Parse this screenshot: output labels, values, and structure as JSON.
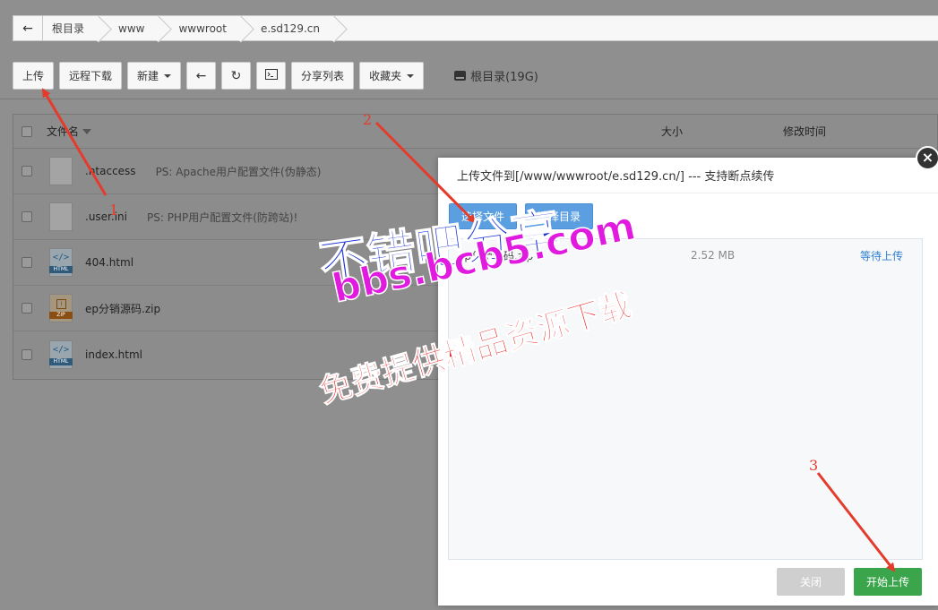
{
  "breadcrumb": {
    "items": [
      "根目录",
      "www",
      "wwwroot",
      "e.sd129.cn"
    ]
  },
  "toolbar": {
    "upload": "上传",
    "remote_download": "远程下载",
    "new": "新建",
    "share_list": "分享列表",
    "favorites": "收藏夹",
    "disk": "根目录(19G)"
  },
  "file_table": {
    "col_name": "文件名",
    "col_size": "大小",
    "col_time": "修改时间",
    "rows": [
      {
        "name": ".htaccess",
        "note": "PS: Apache用户配置文件(伪静态)",
        "icon": "file-icon"
      },
      {
        "name": ".user.ini",
        "note": "PS: PHP用户配置文件(防跨站)!",
        "icon": "file-icon"
      },
      {
        "name": "404.html",
        "note": "",
        "icon": "html-file-icon"
      },
      {
        "name": "ep分销源码.zip",
        "note": "",
        "icon": "zip-file-icon"
      },
      {
        "name": "index.html",
        "note": "",
        "icon": "html-file-icon"
      }
    ]
  },
  "dialog": {
    "title": "上传文件到[/www/wwwroot/e.sd129.cn/] --- 支持断点续传",
    "select_file": "选择文件",
    "select_dir": "选择目录",
    "queue": [
      {
        "name": "ep分销源码.zip",
        "size": "2.52 MB",
        "status": "等待上传"
      }
    ],
    "close": "关闭",
    "start_upload": "开始上传"
  },
  "annotations": {
    "step1": "1",
    "step2": "2",
    "step3": "3",
    "arrow_color": "#e53b2c",
    "watermark_line1": "不错吧分享",
    "watermark_line2": "bbs.bcb5.com",
    "watermark_line3": "免费提供精品资源下载"
  },
  "colors": {
    "primary_blue": "#5b9fe1",
    "success_green": "#3ba54b",
    "link_blue": "#2f7fd1",
    "overlay": "#8f8f8f"
  }
}
